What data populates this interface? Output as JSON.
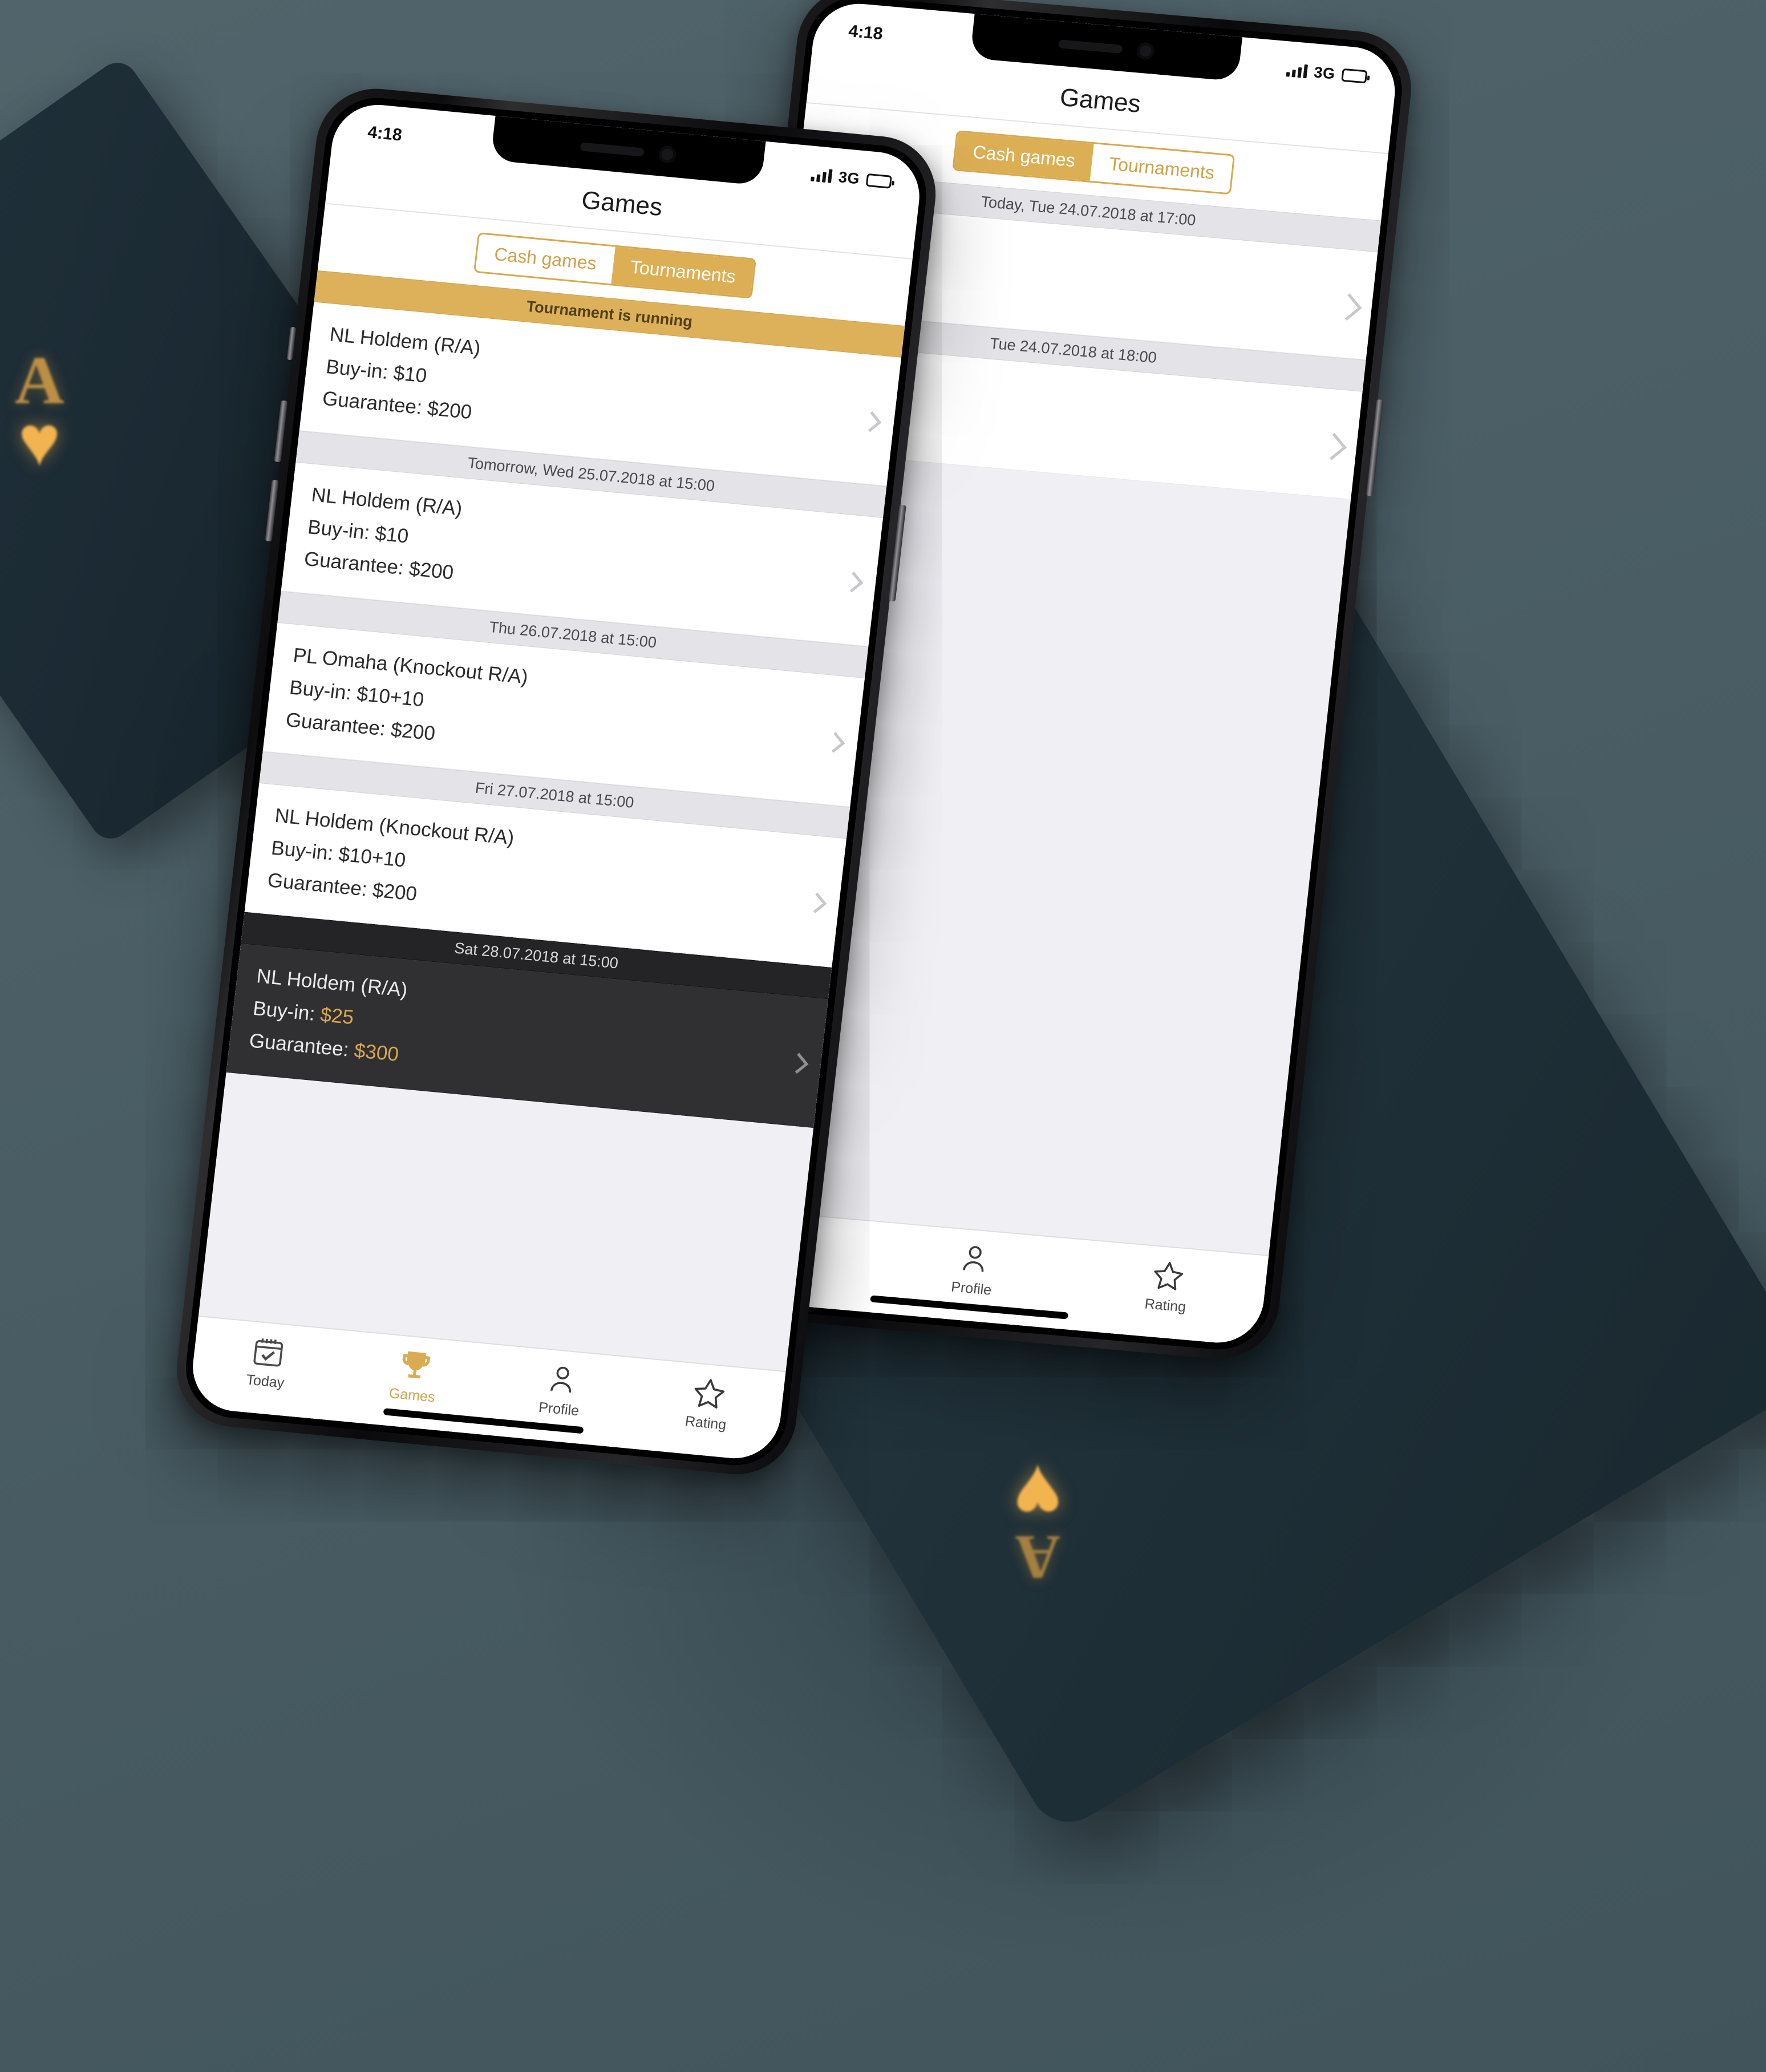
{
  "app": {
    "nav_title": "Games",
    "accent_gold": "#d7a84d",
    "dark_row_bg": "#303033"
  },
  "status_bar": {
    "time": "4:18",
    "network": "3G",
    "signal_icon": "signal-bars-icon",
    "battery_icon": "battery-icon"
  },
  "segmented": {
    "cash_games": "Cash games",
    "tournaments": "Tournaments"
  },
  "front_phone": {
    "nav_title": "Games",
    "active_segment": "Tournaments",
    "sections": [
      {
        "header": "Tournament is running",
        "style": "gold",
        "name": "NL Holdem (R/A)",
        "buyin_label": "Buy-in:",
        "buyin_value": "$10",
        "guarantee_label": "Guarantee:",
        "guarantee_value": "$200"
      },
      {
        "header": "Tomorrow, Wed 25.07.2018 at 15:00",
        "style": "plain",
        "name": "NL Holdem (R/A)",
        "buyin_label": "Buy-in:",
        "buyin_value": "$10",
        "guarantee_label": "Guarantee:",
        "guarantee_value": "$200"
      },
      {
        "header": "Thu 26.07.2018 at 15:00",
        "style": "plain",
        "name": "PL Omaha (Knockout R/A)",
        "buyin_label": "Buy-in:",
        "buyin_value": "$10+10",
        "guarantee_label": "Guarantee:",
        "guarantee_value": "$200"
      },
      {
        "header": "Fri 27.07.2018 at 15:00",
        "style": "plain",
        "name": "NL Holdem (Knockout R/A)",
        "buyin_label": "Buy-in:",
        "buyin_value": "$10+10",
        "guarantee_label": "Guarantee:",
        "guarantee_value": "$200"
      },
      {
        "header": "Sat 28.07.2018 at 15:00",
        "style": "dark",
        "name": "NL Holdem (R/A)",
        "buyin_label": "Buy-in:",
        "buyin_value": "$25",
        "guarantee_label": "Guarantee:",
        "guarantee_value": "$300"
      }
    ]
  },
  "back_phone": {
    "nav_title": "Games",
    "active_segment": "Cash games",
    "sections": [
      {
        "header": "Today, Tue 24.07.2018 at 17:00"
      },
      {
        "header": "Tue 24.07.2018 at 18:00"
      }
    ]
  },
  "tabbar": {
    "items": [
      {
        "label": "Today",
        "icon": "calendar-check-icon",
        "active": false
      },
      {
        "label": "Games",
        "icon": "trophy-icon",
        "active": true
      },
      {
        "label": "Profile",
        "icon": "person-icon",
        "active": false
      },
      {
        "label": "Rating",
        "icon": "star-icon",
        "active": false
      }
    ]
  },
  "decor": {
    "card_rank": "A",
    "card_suit": "♥"
  }
}
